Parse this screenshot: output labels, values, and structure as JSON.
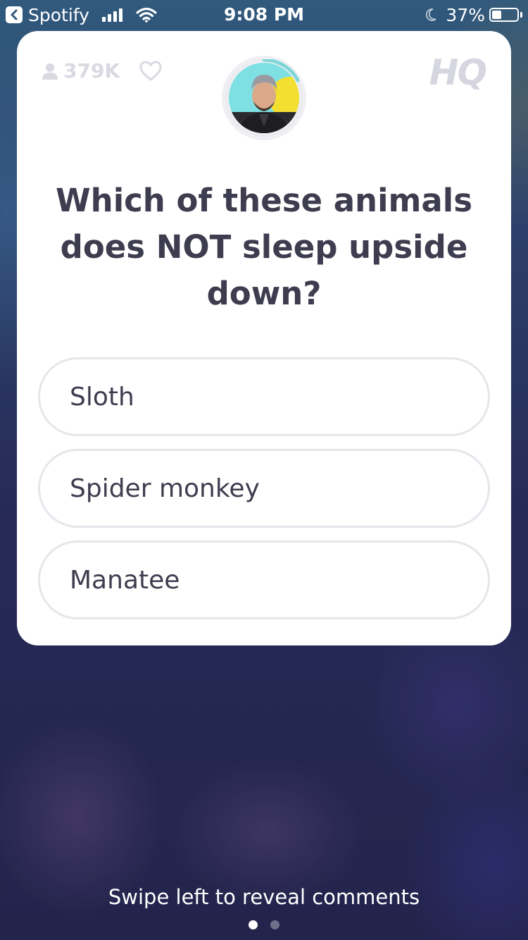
{
  "status_bar": {
    "app_name": "Spotify",
    "time": "9:08 PM",
    "battery_percent": "37%",
    "battery_level": 0.37,
    "signal_bars": 4
  },
  "card": {
    "viewer_count": "379K",
    "logo": "HQ",
    "question": "Which of these animals does NOT sleep upside down?",
    "answers": [
      {
        "label": "Sloth"
      },
      {
        "label": "Spider monkey"
      },
      {
        "label": "Manatee"
      }
    ]
  },
  "footer": {
    "hint": "Swipe left to reveal comments",
    "pages": 2,
    "active_page": 1
  },
  "icons": {
    "back": "back-chevron-icon",
    "signal": "cellular-signal-icon",
    "wifi": "wifi-icon",
    "moon": "do-not-disturb-moon-icon",
    "battery": "battery-icon",
    "person": "person-icon",
    "heart": "heart-icon"
  },
  "colors": {
    "card_background": "#ffffff",
    "question_text": "#3d3d4f",
    "answer_border": "#e6e6ec",
    "muted_icon": "#d9d9e2",
    "avatar_ring_accent": "#7fd6d9"
  }
}
